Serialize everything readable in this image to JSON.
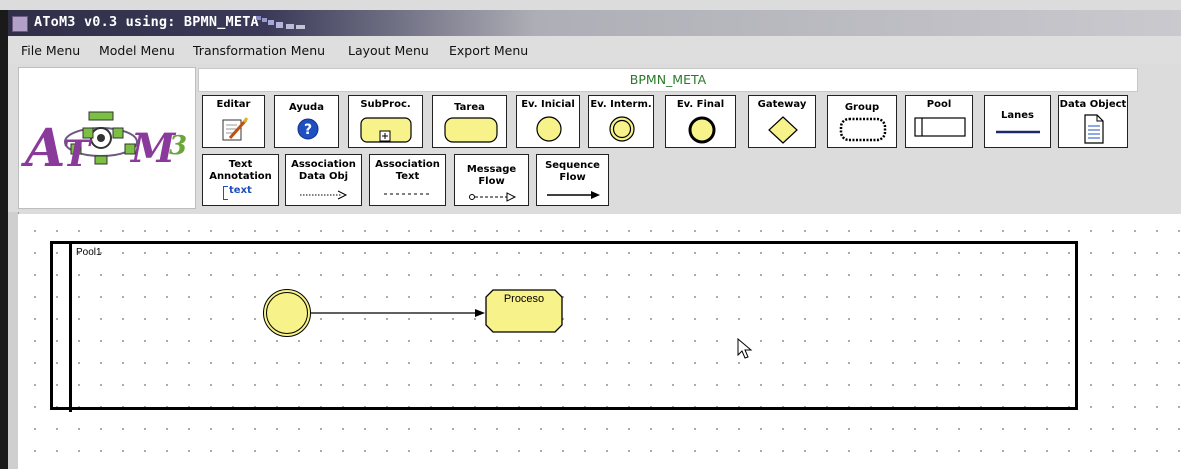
{
  "window": {
    "title": "AToM3 v0.3 using: BPMN_META"
  },
  "menu": [
    "File Menu",
    "Model Menu",
    "Transformation Menu",
    "Layout Menu",
    "Export Menu"
  ],
  "logo": {
    "text": "AToM3"
  },
  "toolbar": {
    "title": "BPMN_META",
    "row1": [
      {
        "label": "Editar",
        "icon": "edit-pencil-icon"
      },
      {
        "label": "Ayuda",
        "icon": "help-question-icon"
      },
      {
        "label": "SubProc.",
        "icon": "subprocess-icon"
      },
      {
        "label": "Tarea",
        "icon": "task-rounded-rect-icon"
      },
      {
        "label": "Ev. Inicial",
        "icon": "start-event-circle-icon"
      },
      {
        "label": "Ev. Interm.",
        "icon": "intermediate-event-double-circle-icon"
      },
      {
        "label": "Ev. Final",
        "icon": "end-event-thick-circle-icon"
      },
      {
        "label": "Gateway",
        "icon": "gateway-diamond-icon"
      },
      {
        "label": "Group",
        "icon": "group-dashed-rounded-rect-icon"
      },
      {
        "label": "Pool",
        "icon": "pool-rect-icon"
      },
      {
        "label": "Lanes",
        "icon": "lanes-line-icon"
      },
      {
        "label": "Data Object",
        "icon": "data-object-document-icon"
      }
    ],
    "row2": [
      {
        "line1": "Text",
        "line2": "Annotation",
        "sample": "text",
        "icon": "text-annotation-icon"
      },
      {
        "line1": "Association",
        "line2": "Data Obj",
        "icon": "association-dotted-arrow-icon"
      },
      {
        "line1": "Association",
        "line2": "Text",
        "icon": "association-dashed-line-icon"
      },
      {
        "line1": "Message",
        "line2": "Flow",
        "icon": "message-flow-icon"
      },
      {
        "line1": "Sequence",
        "line2": "Flow",
        "icon": "sequence-flow-arrow-icon"
      }
    ]
  },
  "canvas": {
    "pool": {
      "label": "Pool1"
    },
    "task": {
      "label": "Proceso"
    }
  },
  "colors": {
    "element_fill": "#f7f28a",
    "meta_title": "#2a7a2a",
    "blue_icon": "#2050c0"
  }
}
